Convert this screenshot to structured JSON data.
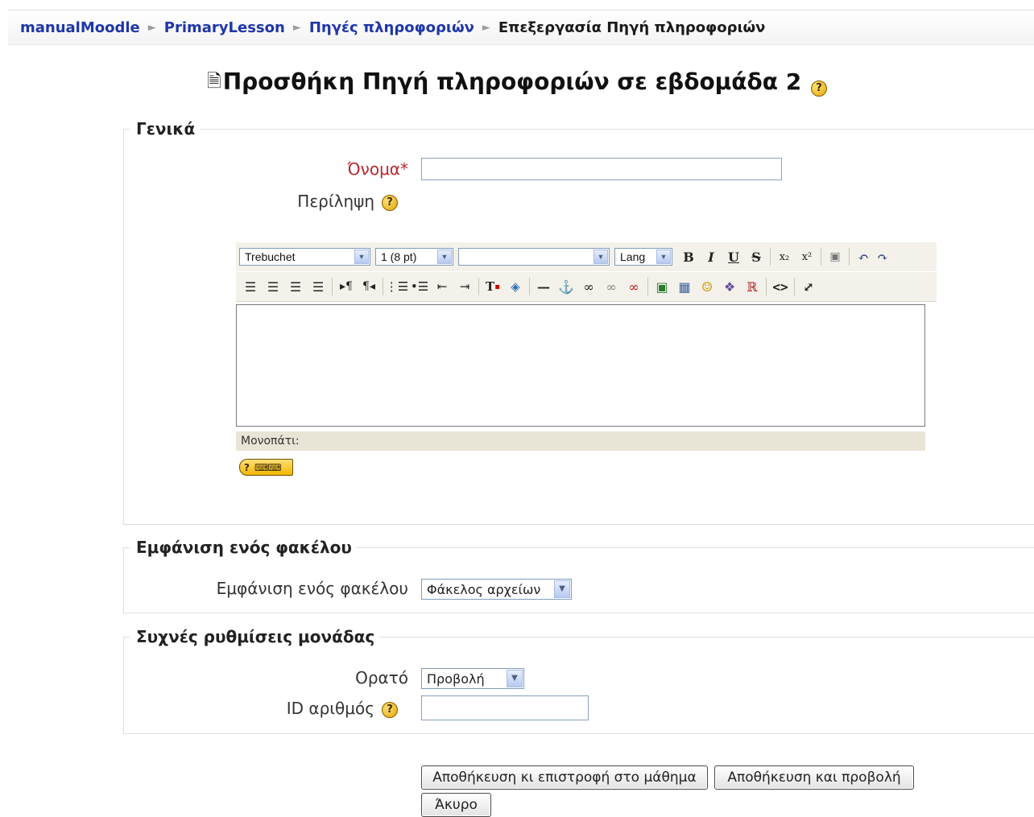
{
  "breadcrumb": {
    "items": [
      "manualMoodle",
      "PrimaryLesson",
      "Πηγές πληροφοριών"
    ],
    "current": "Επεξεργασία Πηγή πληροφοριών",
    "separator": "►"
  },
  "title": {
    "icon": "document-icon",
    "text": "Προσθήκη Πηγή πληροφοριών σε εβδομάδα 2",
    "help": "?"
  },
  "general": {
    "legend": "Γενικά",
    "name_label": "Όνομα*",
    "name_value": "",
    "summary_label": "Περίληψη",
    "summary_help": "?"
  },
  "editor": {
    "font_family": "Trebuchet",
    "font_size": "1 (8 pt)",
    "heading": "",
    "lang": "Lang",
    "path_label": "Μονοπάτι:",
    "content": "",
    "icons_row1": [
      "bold-icon",
      "italic-icon",
      "underline-icon",
      "strikethrough-icon",
      "subscript-icon",
      "superscript-icon",
      "paste-word-icon",
      "undo-icon",
      "redo-icon"
    ],
    "icons_row2": [
      "align-left-icon",
      "align-center-icon",
      "align-right-icon",
      "justify-icon",
      "ltr-icon",
      "rtl-icon",
      "ordered-list-icon",
      "unordered-list-icon",
      "outdent-icon",
      "indent-icon",
      "text-color-icon",
      "background-color-icon",
      "horizontal-rule-icon",
      "anchor-icon",
      "link-icon",
      "unlink-icon",
      "nolink-icon",
      "image-icon",
      "table-icon",
      "smiley-icon",
      "special-char-icon",
      "search-replace-icon",
      "html-source-icon",
      "fullscreen-icon"
    ],
    "help_kbd": "?"
  },
  "folder": {
    "legend": "Εμφάνιση ενός φακέλου",
    "label": "Εμφάνιση ενός φακέλου",
    "value": "Φάκελος αρχείων"
  },
  "common": {
    "legend": "Συχνές ρυθμίσεις μονάδας",
    "visible_label": "Ορατό",
    "visible_value": "Προβολή",
    "id_label": "ID αριθμός",
    "id_help": "?",
    "id_value": ""
  },
  "buttons": {
    "save_return": "Αποθήκευση κι επιστροφή στο μάθημα",
    "save_display": "Αποθήκευση και προβολή",
    "cancel": "Άκυρο"
  },
  "colors": {
    "link": "#1f36a8",
    "required": "#b8282e",
    "toolbar_bg": "#f3f1ea",
    "help_icon": "#f2b600"
  }
}
